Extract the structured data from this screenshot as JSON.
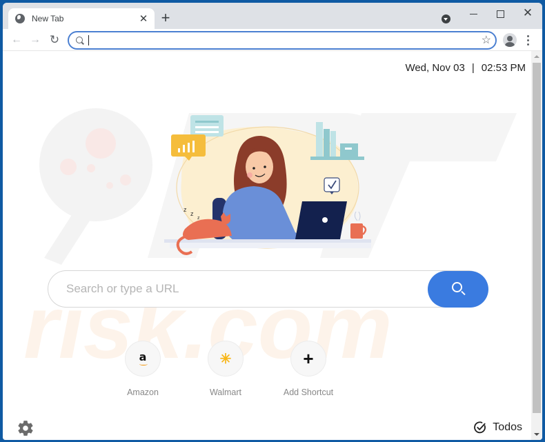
{
  "browser": {
    "tab": {
      "title": "New Tab",
      "close_label": "✕"
    },
    "new_tab_label": "+",
    "window_controls": {
      "close_label": "✕"
    },
    "toolbar": {
      "back_label": "←",
      "forward_label": "→",
      "reload_label": "↻",
      "omnibox_value": "",
      "bookmark_label": "☆"
    }
  },
  "page": {
    "date": "Wed, Nov 03",
    "separator": "|",
    "time": "02:53 PM",
    "search": {
      "placeholder": "Search or type a URL",
      "value": ""
    },
    "shortcuts": [
      {
        "label": "Amazon",
        "icon": "amazon-icon",
        "glyph": "a"
      },
      {
        "label": "Walmart",
        "icon": "walmart-spark-icon",
        "glyph": "✳"
      },
      {
        "label": "Add Shortcut",
        "icon": "plus-icon",
        "glyph": "+"
      }
    ],
    "todos_label": "Todos"
  },
  "colors": {
    "accent": "#3a7be0",
    "omnibox_border": "#4a7fd1",
    "window_frame": "#0f5aa3",
    "amazon_smile": "#f29100",
    "walmart_spark": "#f8b71a"
  }
}
